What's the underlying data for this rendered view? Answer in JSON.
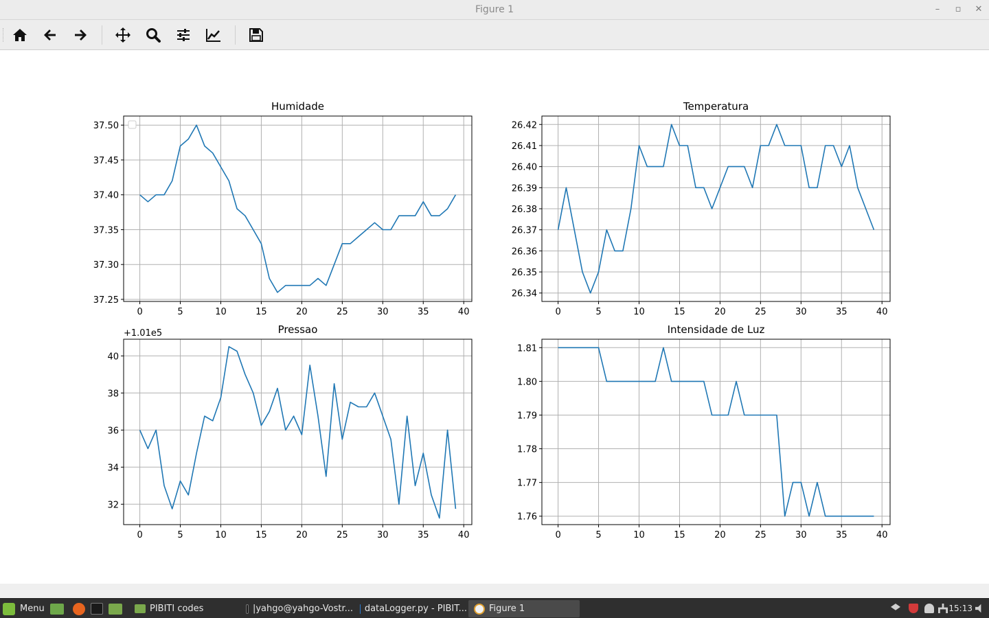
{
  "window": {
    "title": "Figure 1",
    "min_glyph": "–",
    "restore_glyph": "▫",
    "close_glyph": "✕"
  },
  "toolbar": {
    "tools": [
      {
        "name": "home-icon"
      },
      {
        "name": "back-icon"
      },
      {
        "name": "forward-icon"
      },
      {
        "name": "pan-icon"
      },
      {
        "name": "zoom-icon"
      },
      {
        "name": "configure-subplots-icon"
      },
      {
        "name": "edit-axis-icon"
      },
      {
        "name": "save-icon"
      }
    ]
  },
  "colors": {
    "line": "#1f77b4",
    "grid": "#b0b0b0",
    "axis": "#000000"
  },
  "chart_data": [
    {
      "type": "line",
      "title": "Humidade",
      "x": [
        0,
        1,
        2,
        3,
        4,
        5,
        6,
        7,
        8,
        9,
        10,
        11,
        12,
        13,
        14,
        15,
        16,
        17,
        18,
        19,
        20,
        21,
        22,
        23,
        24,
        25,
        26,
        27,
        28,
        29,
        30,
        31,
        32,
        33,
        34,
        35,
        36,
        37,
        38,
        39
      ],
      "y": [
        37.4,
        37.39,
        37.4,
        37.4,
        37.42,
        37.47,
        37.48,
        37.5,
        37.47,
        37.46,
        37.44,
        37.42,
        37.38,
        37.37,
        37.35,
        37.33,
        37.28,
        37.26,
        37.27,
        37.27,
        37.27,
        37.27,
        37.28,
        37.27,
        37.3,
        37.33,
        37.33,
        37.34,
        37.35,
        37.36,
        37.35,
        37.35,
        37.37,
        37.37,
        37.37,
        37.39,
        37.37,
        37.37,
        37.38,
        37.4
      ],
      "xlim": [
        -2,
        41
      ],
      "ylim": [
        37.247,
        37.513
      ],
      "xticks": [
        0,
        5,
        10,
        15,
        20,
        25,
        30,
        35,
        40
      ],
      "xtick_labels": [
        "0",
        "5",
        "10",
        "15",
        "20",
        "25",
        "30",
        "35",
        "40"
      ],
      "yticks": [
        37.25,
        37.3,
        37.35,
        37.4,
        37.45,
        37.5
      ],
      "ytick_labels": [
        "37.25",
        "37.30",
        "37.35",
        "37.40",
        "37.45",
        "37.50"
      ],
      "offset_text": "",
      "grid": true,
      "legend": {
        "placement": "upper-left",
        "entries": []
      }
    },
    {
      "type": "line",
      "title": "Temperatura",
      "x": [
        0,
        1,
        2,
        3,
        4,
        5,
        6,
        7,
        8,
        9,
        10,
        11,
        12,
        13,
        14,
        15,
        16,
        17,
        18,
        19,
        20,
        21,
        22,
        23,
        24,
        25,
        26,
        27,
        28,
        29,
        30,
        31,
        32,
        33,
        34,
        35,
        36,
        37,
        38,
        39
      ],
      "y": [
        26.37,
        26.39,
        26.37,
        26.35,
        26.34,
        26.35,
        26.37,
        26.36,
        26.36,
        26.38,
        26.41,
        26.4,
        26.4,
        26.4,
        26.42,
        26.41,
        26.41,
        26.39,
        26.39,
        26.38,
        26.39,
        26.4,
        26.4,
        26.4,
        26.39,
        26.41,
        26.41,
        26.42,
        26.41,
        26.41,
        26.41,
        26.39,
        26.39,
        26.41,
        26.41,
        26.4,
        26.41,
        26.39,
        26.38,
        26.37
      ],
      "xlim": [
        -2,
        41
      ],
      "ylim": [
        26.336,
        26.424
      ],
      "xticks": [
        0,
        5,
        10,
        15,
        20,
        25,
        30,
        35,
        40
      ],
      "xtick_labels": [
        "0",
        "5",
        "10",
        "15",
        "20",
        "25",
        "30",
        "35",
        "40"
      ],
      "yticks": [
        26.34,
        26.35,
        26.36,
        26.37,
        26.38,
        26.39,
        26.4,
        26.41,
        26.42
      ],
      "ytick_labels": [
        "26.34",
        "26.35",
        "26.36",
        "26.37",
        "26.38",
        "26.39",
        "26.40",
        "26.41",
        "26.42"
      ],
      "offset_text": "",
      "grid": true
    },
    {
      "type": "line",
      "title": "Pressao",
      "x": [
        0,
        1,
        2,
        3,
        4,
        5,
        6,
        7,
        8,
        9,
        10,
        11,
        12,
        13,
        14,
        15,
        16,
        17,
        18,
        19,
        20,
        21,
        22,
        23,
        24,
        25,
        26,
        27,
        28,
        29,
        30,
        31,
        32,
        33,
        34,
        35,
        36,
        37,
        38,
        39
      ],
      "y": [
        101036.0,
        101035.0,
        101036.0,
        101033.0,
        101031.75,
        101033.25,
        101032.5,
        101034.75,
        101036.75,
        101036.5,
        101037.75,
        101040.5,
        101040.25,
        101039.0,
        101038.0,
        101036.25,
        101037.0,
        101038.25,
        101036.0,
        101036.75,
        101035.75,
        101039.5,
        101036.75,
        101033.5,
        101038.5,
        101035.5,
        101037.5,
        101037.25,
        101037.25,
        101038.0,
        101036.75,
        101035.5,
        101032.0,
        101036.75,
        101033.0,
        101034.75,
        101032.5,
        101031.25,
        101036.0,
        101031.75
      ],
      "xlim": [
        -2,
        41
      ],
      "ylim": [
        101030.9,
        101040.9
      ],
      "xticks": [
        0,
        5,
        10,
        15,
        20,
        25,
        30,
        35,
        40
      ],
      "xtick_labels": [
        "0",
        "5",
        "10",
        "15",
        "20",
        "25",
        "30",
        "35",
        "40"
      ],
      "yticks": [
        101032,
        101034,
        101036,
        101038,
        101040
      ],
      "ytick_labels": [
        "32",
        "34",
        "36",
        "38",
        "40"
      ],
      "offset_text": "+1.01e5",
      "grid": true
    },
    {
      "type": "line",
      "title": "Intensidade de Luz",
      "x": [
        0,
        1,
        2,
        3,
        4,
        5,
        6,
        7,
        8,
        9,
        10,
        11,
        12,
        13,
        14,
        15,
        16,
        17,
        18,
        19,
        20,
        21,
        22,
        23,
        24,
        25,
        26,
        27,
        28,
        29,
        30,
        31,
        32,
        33,
        34,
        35,
        36,
        37,
        38,
        39
      ],
      "y": [
        1.81,
        1.81,
        1.81,
        1.81,
        1.81,
        1.81,
        1.8,
        1.8,
        1.8,
        1.8,
        1.8,
        1.8,
        1.8,
        1.81,
        1.8,
        1.8,
        1.8,
        1.8,
        1.8,
        1.79,
        1.79,
        1.79,
        1.8,
        1.79,
        1.79,
        1.79,
        1.79,
        1.79,
        1.76,
        1.77,
        1.77,
        1.76,
        1.77,
        1.76,
        1.76,
        1.76,
        1.76,
        1.76,
        1.76,
        1.76
      ],
      "xlim": [
        -2,
        41
      ],
      "ylim": [
        1.7575,
        1.8125
      ],
      "xticks": [
        0,
        5,
        10,
        15,
        20,
        25,
        30,
        35,
        40
      ],
      "xtick_labels": [
        "0",
        "5",
        "10",
        "15",
        "20",
        "25",
        "30",
        "35",
        "40"
      ],
      "yticks": [
        1.76,
        1.77,
        1.78,
        1.79,
        1.8,
        1.81
      ],
      "ytick_labels": [
        "1.76",
        "1.77",
        "1.78",
        "1.79",
        "1.80",
        "1.81"
      ],
      "offset_text": "",
      "grid": true
    }
  ],
  "taskbar": {
    "menu_label": "Menu",
    "tasks": [
      {
        "label": "PIBITI codes",
        "icon": "folder-icon"
      },
      {
        "label": "|yahgo@yahgo-Vostr...",
        "icon": "terminal-icon"
      },
      {
        "label": "dataLogger.py - PIBIT...",
        "icon": "vscode-icon"
      },
      {
        "label": "Figure 1",
        "icon": "matplotlib-icon"
      }
    ],
    "clock": "15:13"
  }
}
